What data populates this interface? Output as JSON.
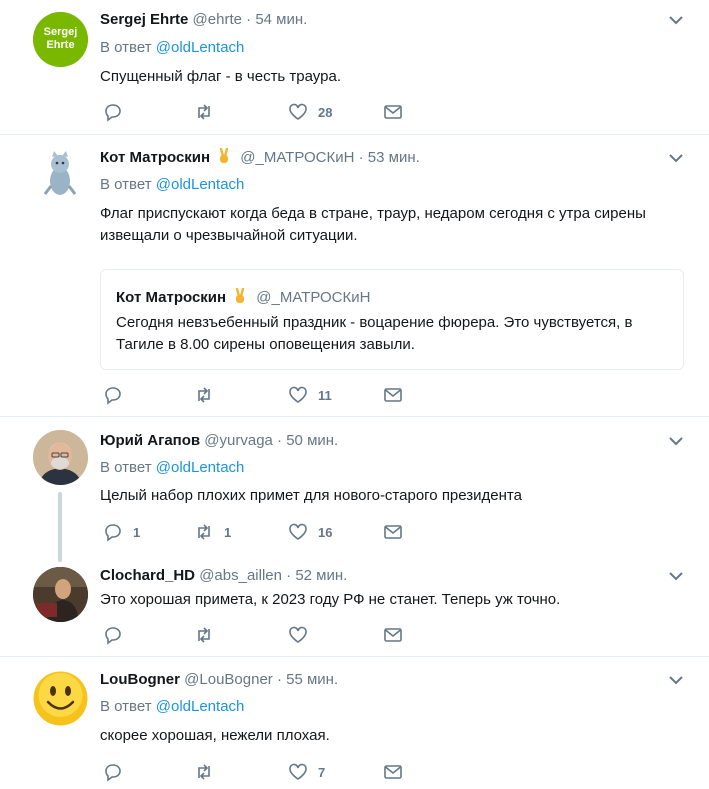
{
  "tweets": [
    {
      "name": "Sergej Ehrte",
      "handle": "@ehrte",
      "dot": "·",
      "time": "54 мин.",
      "avatar_text_1": "Sergej",
      "avatar_text_2": "Ehrte",
      "reply_prefix": "В ответ",
      "reply_to": "@oldLentach",
      "text": "Спущенный флаг - в честь траура.",
      "counts": {
        "reply": "",
        "retweet": "",
        "like": "28"
      }
    },
    {
      "name": "Кот Матроскин",
      "handle": "@_МАТРОСКиН",
      "dot": "·",
      "time": "53 мин.",
      "reply_prefix": "В ответ",
      "reply_to": "@oldLentach",
      "text": "Флаг приспускают когда беда в стране, траур, недаром сегодня с утра сирены извещали о чрезвычайной ситуации.",
      "quote": {
        "name": "Кот Матроскин",
        "handle": "@_МАТРОСКиН",
        "text": "Сегодня невзъебенный праздник - воцарение фюрера. Это чувствуется, в Тагиле в 8.00 сирены оповещения завыли."
      },
      "counts": {
        "reply": "",
        "retweet": "",
        "like": "11"
      }
    },
    {
      "name": "Юрий Агапов",
      "handle": "@yurvaga",
      "dot": "·",
      "time": "50 мин.",
      "reply_prefix": "В ответ",
      "reply_to": "@oldLentach",
      "text": "Целый набор плохих примет для нового-старого президента",
      "counts": {
        "reply": "1",
        "retweet": "1",
        "like": "16"
      }
    },
    {
      "name": "Clochard_HD",
      "handle": "@abs_aillen",
      "dot": "·",
      "time": "52 мин.",
      "text": "Это хорошая примета, к 2023 году РФ не станет. Теперь уж точно.",
      "counts": {
        "reply": "",
        "retweet": "",
        "like": ""
      }
    },
    {
      "name": "LouBogner",
      "handle": "@LouBogner",
      "dot": "·",
      "time": "55 мин.",
      "reply_prefix": "В ответ",
      "reply_to": "@oldLentach",
      "text": "скорее хорошая, нежели плохая.",
      "counts": {
        "reply": "",
        "retweet": "",
        "like": "7"
      }
    }
  ],
  "colors": {
    "text": "#14171a",
    "secondary": "#657786",
    "link": "#1b95e0",
    "border": "#e6ecf0",
    "avatar_green": "#7ab800"
  },
  "icons": [
    "reply-icon",
    "retweet-icon",
    "like-icon",
    "direct-message-icon",
    "chevron-down-icon",
    "victory-hand-emoji"
  ]
}
